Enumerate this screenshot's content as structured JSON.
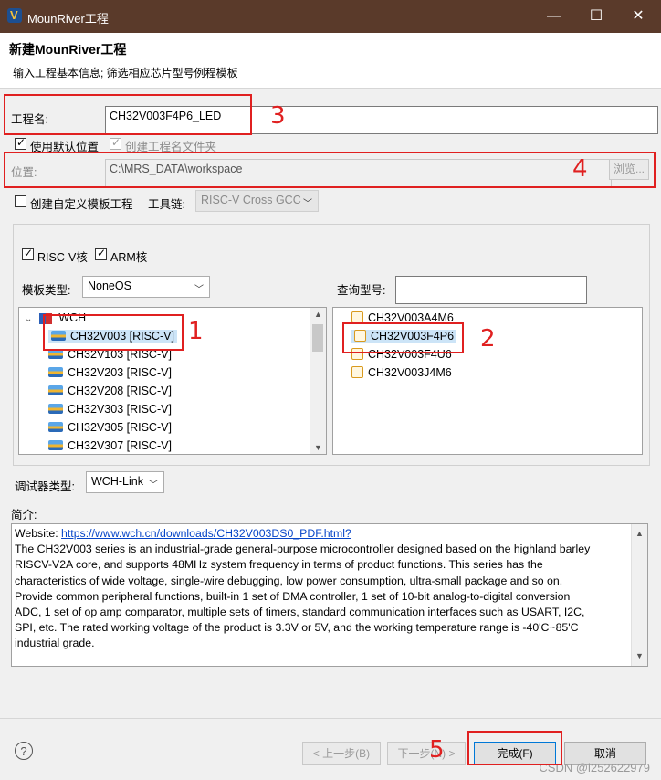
{
  "window": {
    "title": "MounRiver工程",
    "minimize": "—",
    "maximize": "☐",
    "close": "✕"
  },
  "header": {
    "title": "新建MounRiver工程",
    "subtitle": "输入工程基本信息; 筛选相应芯片型号例程模板"
  },
  "project": {
    "name_label": "工程名:",
    "name_value": "CH32V003F4P6_LED"
  },
  "options": {
    "use_default_location": "使用默认位置",
    "create_folder": "创建工程名文件夹"
  },
  "location": {
    "label": "位置:",
    "value": "C:\\MRS_DATA\\workspace",
    "browse": "浏览..."
  },
  "custom": {
    "label": "创建自定义模板工程",
    "toolchain_label": "工具链:",
    "toolchain_value": "RISC-V Cross GCC"
  },
  "cores": {
    "riscv": "RISC-V核",
    "arm": "ARM核"
  },
  "template": {
    "type_label": "模板类型:",
    "type_value": "NoneOS",
    "query_label": "查询型号:",
    "query_value": ""
  },
  "tree": {
    "root": "WCH",
    "items": [
      "CH32V003 [RISC-V]",
      "CH32V103 [RISC-V]",
      "CH32V203 [RISC-V]",
      "CH32V208 [RISC-V]",
      "CH32V303 [RISC-V]",
      "CH32V305 [RISC-V]",
      "CH32V307 [RISC-V]"
    ]
  },
  "models": [
    "CH32V003A4M6",
    "CH32V003F4P6",
    "CH32V003F4U6",
    "CH32V003J4M6"
  ],
  "debugger": {
    "label": "调试器类型:",
    "value": "WCH-Link"
  },
  "intro": {
    "label": "简介:",
    "website_label": "Website:",
    "website_url": "https://www.wch.cn/downloads/CH32V003DS0_PDF.html?",
    "lines": [
      "The CH32V003 series is an industrial-grade general-purpose microcontroller designed based on the highland barley",
      "RISCV-V2A core, and supports 48MHz system frequency in terms of product functions. This series has the",
      "characteristics of wide voltage, single-wire debugging, low power consumption, ultra-small package and so on.",
      "Provide common peripheral functions, built-in 1 set of DMA controller, 1 set of 10-bit analog-to-digital conversion",
      "ADC, 1 set of op amp comparator, multiple sets of timers, standard communication interfaces such as USART, I2C,",
      "SPI, etc. The rated working voltage of the product is 3.3V or 5V, and the working temperature range is -40'C~85'C",
      "industrial grade."
    ]
  },
  "footer": {
    "help": "?",
    "back": "< 上一步(B)",
    "next": "下一步(N) >",
    "finish": "完成(F)",
    "cancel": "取消",
    "watermark": "CSDN @l252622979"
  },
  "annotations": [
    "1",
    "2",
    "3",
    "4",
    "5"
  ],
  "colors": {
    "annotation": "#e02020",
    "titlebar": "#5a3a2a",
    "link": "#0645c8"
  }
}
